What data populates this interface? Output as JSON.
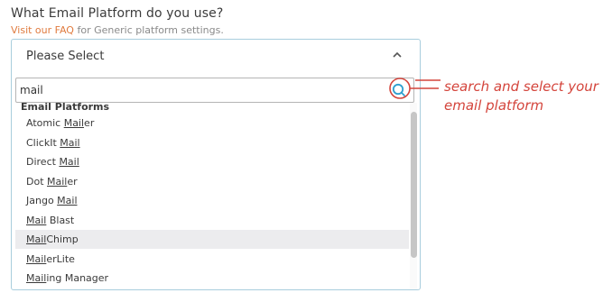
{
  "form": {
    "question": "What Email Platform do you use?",
    "help_link": "Visit our FAQ",
    "help_rest": " for Generic platform settings."
  },
  "dropdown": {
    "selected": "Please Select",
    "caret_icon": "chevron-up-icon",
    "search_value": "mail",
    "search_icon": "search-icon",
    "search_icon_color": "#2f9fcf",
    "group_label": "Email Platforms",
    "options": [
      {
        "pre": "Atomic ",
        "match": "Mail",
        "post": "er"
      },
      {
        "pre": "ClickIt ",
        "match": "Mail",
        "post": ""
      },
      {
        "pre": "Direct ",
        "match": "Mail",
        "post": ""
      },
      {
        "pre": "Dot ",
        "match": "Mail",
        "post": "er"
      },
      {
        "pre": "Jango ",
        "match": "Mail",
        "post": ""
      },
      {
        "pre": "",
        "match": "Mail",
        "post": " Blast"
      },
      {
        "pre": "",
        "match": "Mail",
        "post": "Chimp"
      },
      {
        "pre": "",
        "match": "Mail",
        "post": "erLite"
      },
      {
        "pre": "",
        "match": "Mail",
        "post": "ing Manager"
      }
    ],
    "highlighted_index": 6
  },
  "annotation": {
    "line1": "search and select your",
    "line2": "email platform",
    "color": "#d4453c"
  }
}
